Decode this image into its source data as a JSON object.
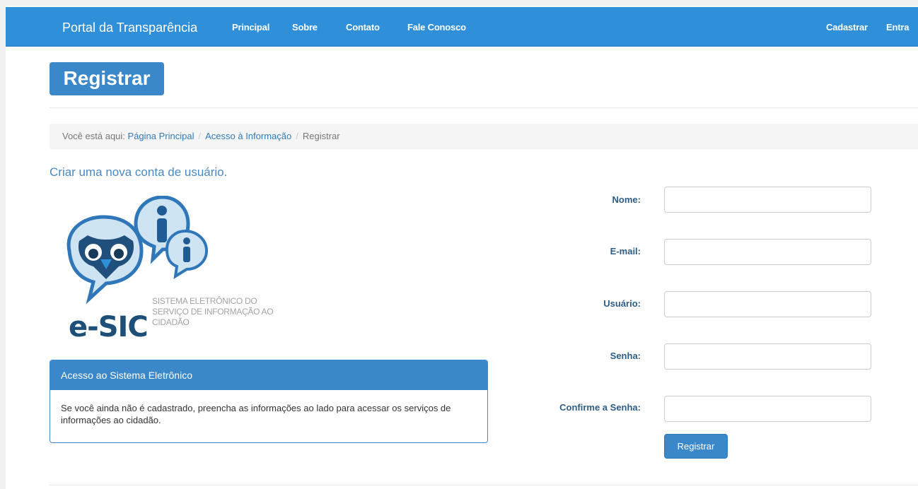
{
  "navbar": {
    "brand": "Portal da Transparência",
    "links": [
      "Principal",
      "Sobre",
      "Contato",
      "Fale Conosco"
    ],
    "right_links": [
      "Cadastrar",
      "Entra"
    ]
  },
  "page_title": "Registrar",
  "breadcrumb": {
    "prefix": "Você está aqui:",
    "items": [
      "Página Principal",
      "Acesso à Informação"
    ],
    "current": "Registrar"
  },
  "subtitle": "Criar uma nova conta de usuário.",
  "logo": {
    "name": "e-SIC",
    "line1": "SISTEMA ELETRÔNICO DO",
    "line2": "SERVIÇO DE INFORMAÇÃO AO",
    "line3": "CIDADÃO"
  },
  "panel": {
    "title": "Acesso ao Sistema Eletrônico",
    "body": "Se você ainda não é cadastrado, preencha as informações ao lado para acessar os serviços de informações ao cidadão."
  },
  "form": {
    "name_label": "Nome:",
    "email_label": "E-mail:",
    "user_label": "Usuário:",
    "password_label": "Senha:",
    "confirm_label": "Confirme a Senha:",
    "name_value": "",
    "email_value": "",
    "user_value": "",
    "password_value": "",
    "confirm_value": "",
    "submit": "Registrar"
  },
  "colors": {
    "navbar": "#2f8fd8",
    "accent": "#3a87c9"
  }
}
